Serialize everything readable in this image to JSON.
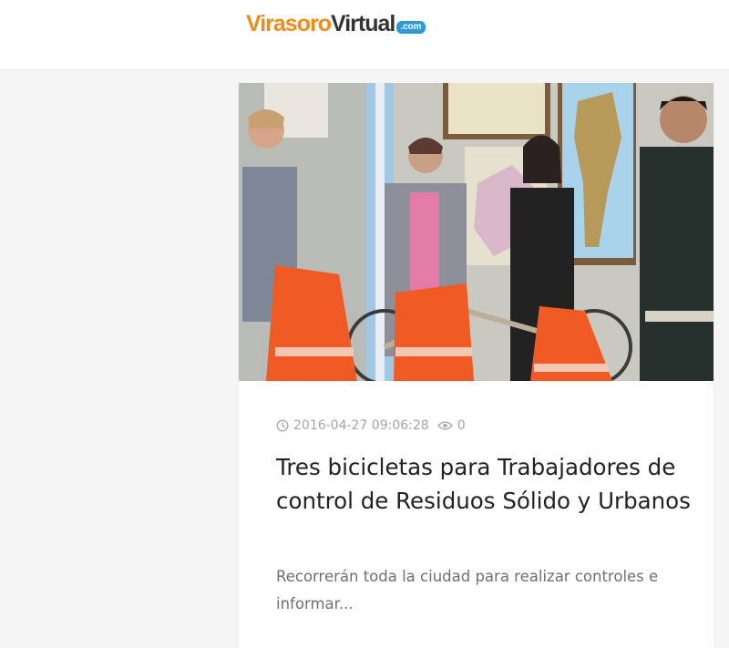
{
  "header": {
    "logo": {
      "part1": "Virasoro",
      "part2": "Virtual",
      "badge": ".com",
      "colors": {
        "part1": "#f28a17",
        "part2": "#333333",
        "badge_bg": "#2b9ad6"
      }
    }
  },
  "article": {
    "image_description": "photo",
    "meta": {
      "clock_icon": "clock-icon",
      "datetime": "2016-04-27 09:06:28",
      "views_icon": "eye-icon",
      "views": "0"
    },
    "title": "Tres bicicletas para Trabajadores de control de Residuos Sólido y Urbanos",
    "excerpt": "Recorrerán toda la ciudad para realizar controles e informar..."
  }
}
